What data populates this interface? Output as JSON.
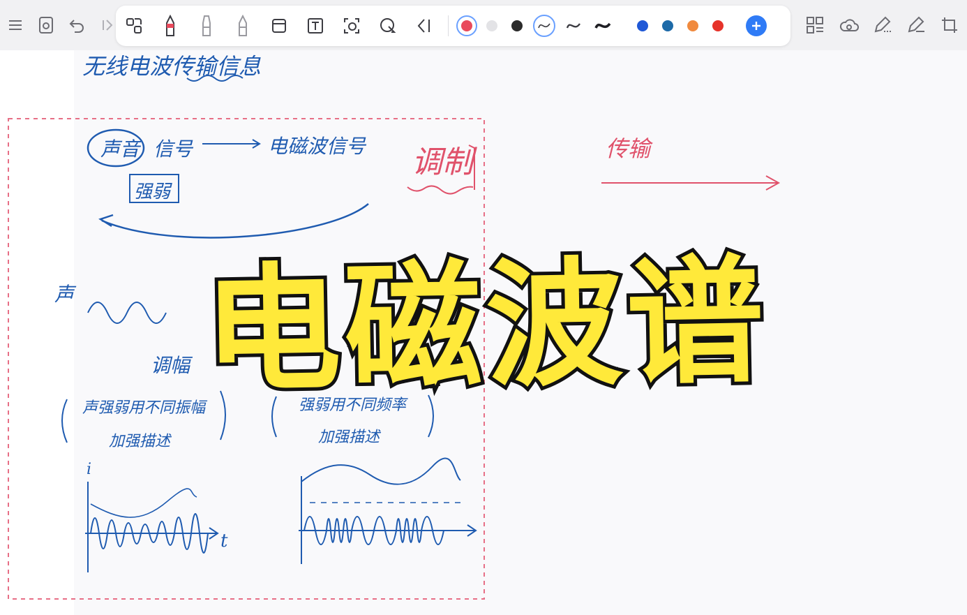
{
  "colors": {
    "selected_color": "#e94a5c",
    "palette": [
      "#e94a5c",
      "#e3e3e6",
      "#2b2b2b",
      "#1f58d6",
      "#1d6aa8",
      "#f08a3e",
      "#e6332a"
    ],
    "ink_blue": "#1f5bb0",
    "ink_red": "#e0526b",
    "accent": "#2f7bf6",
    "title_fill": "#ffe93a",
    "title_stroke": "#111111"
  },
  "toolbar": {
    "left_icons": [
      "menu-icon",
      "preview-icon",
      "undo-icon",
      "redo-icon"
    ],
    "pen_tools": [
      "lasso-select-icon",
      "pen-icon",
      "marker-icon",
      "highlighter-icon",
      "eraser-icon",
      "text-icon",
      "image-icon",
      "shape-icon",
      "collapse-icon"
    ],
    "stroke_options": [
      "thin-stroke-icon",
      "medium-stroke-icon",
      "thick-stroke-icon"
    ],
    "right_icons": [
      "grid-icon",
      "cloud-sync-icon",
      "pen-settings-icon",
      "edit-icon",
      "crop-icon"
    ]
  },
  "notes": {
    "top_line": "无线电波传输信息",
    "line1_a": "声音",
    "line1_b": "信号",
    "line1_c": "电磁波信号",
    "box_word": "强弱",
    "red_word_1": "调制",
    "red_word_2": "传输",
    "side_char": "声",
    "mid_label": "调幅",
    "paren_1": "声强弱用不同振幅",
    "paren_1b": "加强描述",
    "paren_2": "强弱用不同频率",
    "paren_2b": "加强描述",
    "axis_t": "t",
    "axis_i": "i"
  },
  "overlay": {
    "title": "电磁波谱"
  }
}
